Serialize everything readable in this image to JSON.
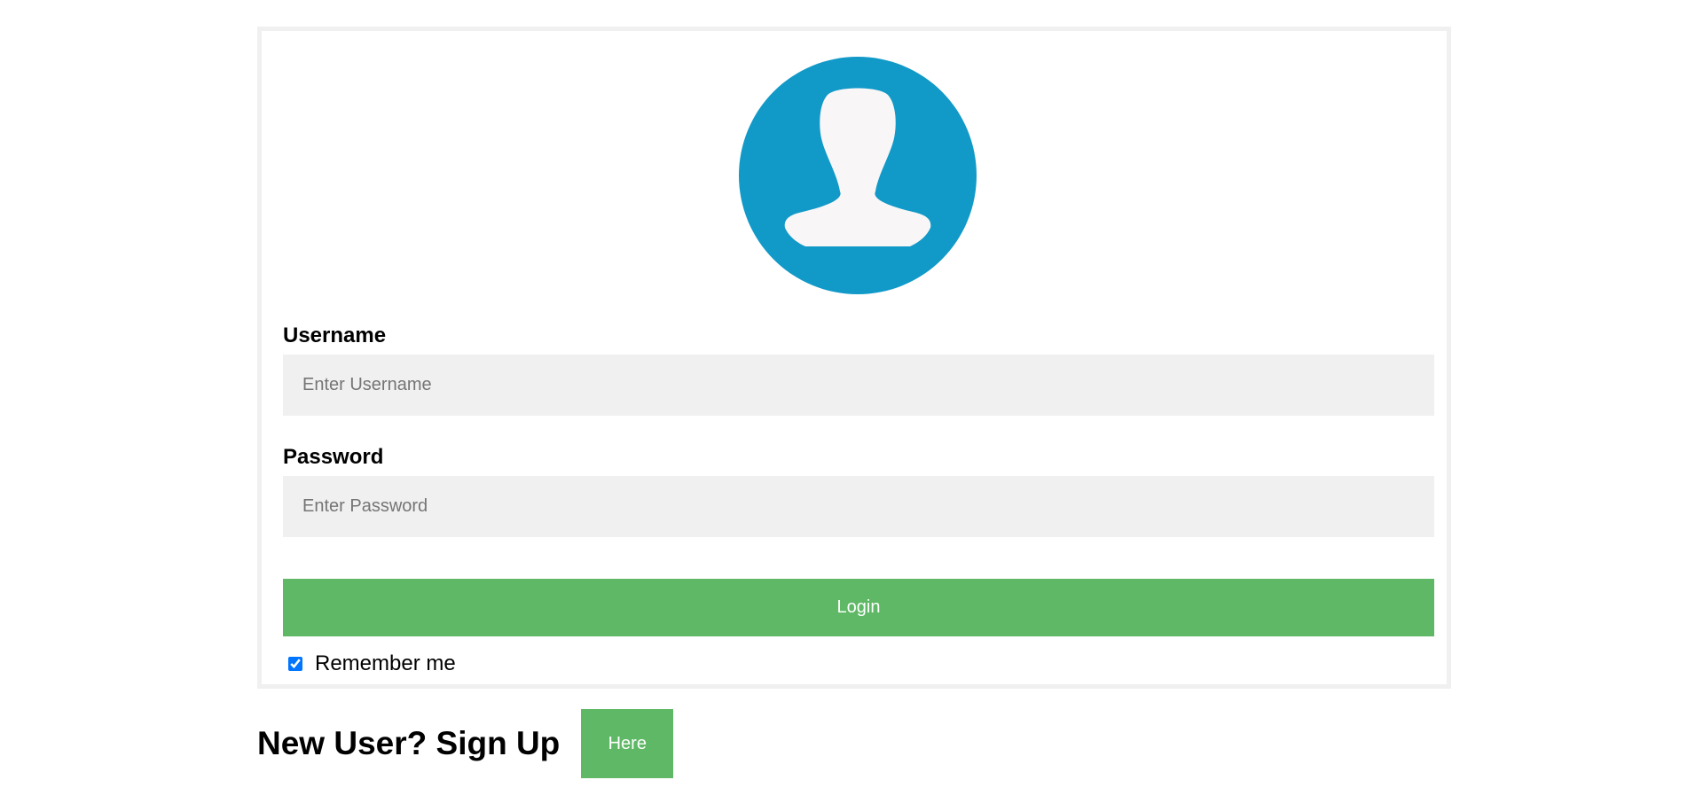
{
  "login_form": {
    "avatar_icon": "user-silhouette-icon",
    "colors": {
      "avatar_background": "#1199c8",
      "avatar_figure": "#f8f6f6",
      "input_background": "#f0f0f0",
      "button_background": "#5eb865",
      "button_text": "#ffffff",
      "container_border": "#f0f0f0"
    },
    "username": {
      "label": "Username",
      "placeholder": "Enter Username",
      "value": ""
    },
    "password": {
      "label": "Password",
      "placeholder": "Enter Password",
      "value": ""
    },
    "login_button_label": "Login",
    "remember_me": {
      "label": "Remember me",
      "checked": true
    }
  },
  "signup": {
    "heading": "New User? Sign Up",
    "button_label": "Here"
  }
}
